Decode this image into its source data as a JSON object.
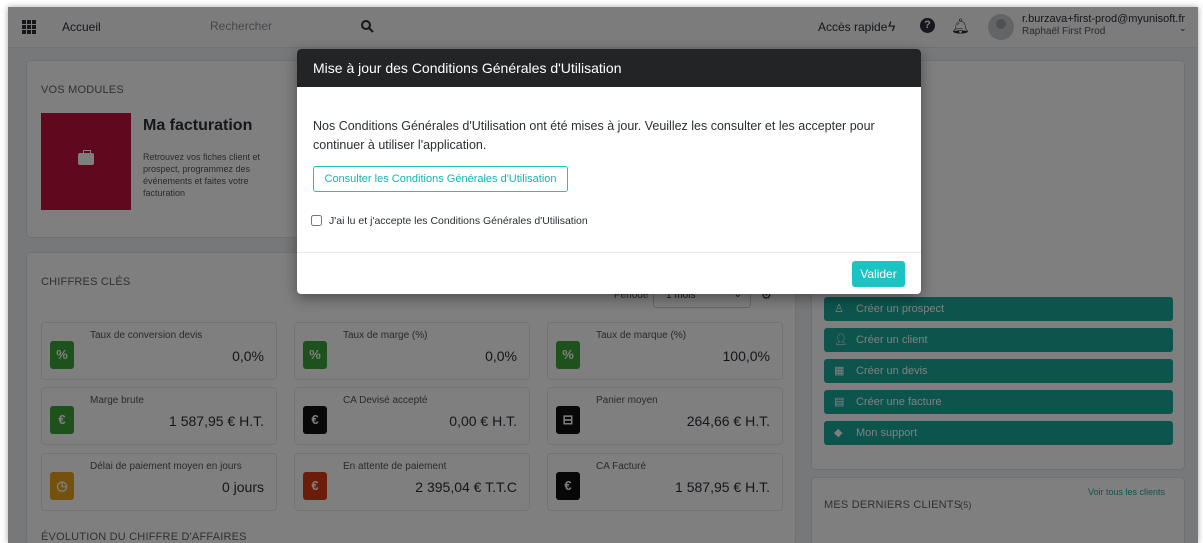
{
  "topbar": {
    "home": "Accueil",
    "search_placeholder": "Rechercher",
    "quick_access": "Accès rapide",
    "user_email": "r.burzava+first-prod@myunisoft.fr",
    "user_name": "Raphaël First Prod"
  },
  "modules": {
    "section_title": "VOS MODULES",
    "card_title": "Ma facturation",
    "card_description": "Retrouvez vos fiches client et prospect, programmez des événements et faites votre facturation",
    "card_color": "#c0103a"
  },
  "key_figures": {
    "section_title": "CHIFFRES CLÉS",
    "period_label": "Période",
    "period_value": "1 mois",
    "items": [
      {
        "label": "Taux de conversion devis",
        "value": "0,0%",
        "icon": "%",
        "color": "#3aa43a"
      },
      {
        "label": "Taux de marge (%)",
        "value": "0,0%",
        "icon": "%",
        "color": "#3aa43a"
      },
      {
        "label": "Taux de marque (%)",
        "value": "100,0%",
        "icon": "%",
        "color": "#3aa43a"
      },
      {
        "label": "Marge brute",
        "value": "1 587,95 € H.T.",
        "icon": "€",
        "color": "#3aa43a"
      },
      {
        "label": "CA Devisé accepté",
        "value": "0,00 € H.T.",
        "icon": "€",
        "color": "#111111"
      },
      {
        "label": "Panier moyen",
        "value": "264,66 € H.T.",
        "icon": "basket",
        "color": "#111111"
      },
      {
        "label": "Délai de paiement moyen en jours",
        "value": "0 jours",
        "icon": "clock",
        "color": "#e8a21a"
      },
      {
        "label": "En attente de paiement",
        "value": "2 395,04 € T.T.C",
        "icon": "€",
        "color": "#d63a12"
      },
      {
        "label": "CA Facturé",
        "value": "1 587,95 € H.T.",
        "icon": "€",
        "color": "#111111"
      }
    ]
  },
  "revenue": {
    "section_title": "ÉVOLUTION DU CHIFFRE D'AFFAIRES"
  },
  "quick_actions": [
    {
      "label": "Créer un prospect",
      "icon": "person-icon"
    },
    {
      "label": "Créer un client",
      "icon": "user-icon"
    },
    {
      "label": "Créer un devis",
      "icon": "calendar-icon"
    },
    {
      "label": "Créer une facture",
      "icon": "document-icon"
    },
    {
      "label": "Mon support",
      "icon": "tag-icon"
    }
  ],
  "last_clients": {
    "title": "MES DERNIERS CLIENTS",
    "count": "(5)",
    "see_all": "Voir tous les clients"
  },
  "modal": {
    "title": "Mise à jour des Conditions Générales d'Utilisation",
    "message": "Nos Conditions Générales d'Utilisation ont été mises à jour. Veuillez les consulter et les accepter pour continuer à utiliser l'application.",
    "consult_button": "Consulter les Conditions Générales d'Utilisation",
    "checkbox_label": "J'ai lu et j'accepte les Conditions Générales d'Utilisation",
    "validate_button": "Valider",
    "accent_color": "#1cc3c3"
  }
}
